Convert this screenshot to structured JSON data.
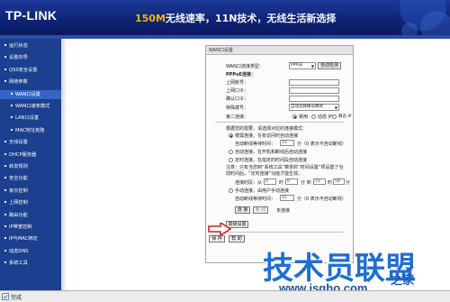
{
  "header": {
    "logo": "TP-LINK",
    "slogan_highlight": "150M",
    "slogan_rest": "无线速率，11N技术，无线生活新选择"
  },
  "menu": {
    "items": [
      {
        "label": "运行状态",
        "sub": false
      },
      {
        "label": "设置向导",
        "sub": false
      },
      {
        "label": "QSS安全设置",
        "sub": false
      },
      {
        "label": "网络参数",
        "sub": false
      },
      {
        "label": "WAN口设置",
        "sub": true,
        "active": true
      },
      {
        "label": "WAN口速率模式",
        "sub": true
      },
      {
        "label": "LAN口设置",
        "sub": true
      },
      {
        "label": "MAC地址克隆",
        "sub": true
      },
      {
        "label": "无线设置",
        "sub": false
      },
      {
        "label": "DHCP服务器",
        "sub": false
      },
      {
        "label": "转发规则",
        "sub": false
      },
      {
        "label": "安全功能",
        "sub": false
      },
      {
        "label": "家长控制",
        "sub": false
      },
      {
        "label": "上网控制",
        "sub": false
      },
      {
        "label": "路由功能",
        "sub": false
      },
      {
        "label": "IP带宽控制",
        "sub": false
      },
      {
        "label": "IP与MAC绑定",
        "sub": false
      },
      {
        "label": "动态DNS",
        "sub": false
      },
      {
        "label": "系统工具",
        "sub": false
      }
    ]
  },
  "panel": {
    "title": "WAN口设置",
    "wan_type_label": "WAN口连接类型：",
    "wan_type_value": "PPPoE",
    "auto_detect": "自动检测",
    "pppoe_conn": "PPPoE连接：",
    "account_label": "上网账号：",
    "password_label": "上网口令：",
    "confirm_label": "确认口令：",
    "special_dial_label": "特殊拨号：",
    "special_dial_value": "自动选择拨号模式",
    "second_conn_label": "第二连接：",
    "radio_disabled": "禁用",
    "radio_dynamic": "动态 IP",
    "radio_static": "静态 IP",
    "mode_hint": "根据您的需要，请选择对应的连接模式：",
    "opt_demand": "按需连接，在有访问时自动连接",
    "idle_label": "自动断线等待时间：",
    "idle_value": "15",
    "idle_unit": "分（0 表示不自动断线）",
    "opt_auto": "自动连接，在开机和断线后自动连接",
    "opt_timed": "定时连接，在指定的时间段自动连接",
    "note": "注意：只有当您到“系统工具”菜单的“时间设置”项设置了当前时间后，“定时连接”功能才能生效。",
    "period_label": "连接时段：从",
    "from_h": "0",
    "unit_h": "时",
    "from_m": "0",
    "unit_m_to": "分 到",
    "to_h": "23",
    "to_m": "59",
    "unit_m": "分",
    "opt_manual": "手动连接，由用户手动连接",
    "idle2_value": "15",
    "connect_btn": "连 接",
    "disconnect_btn": "断 线",
    "not_connected": "未连接",
    "advanced_btn": "高级设置",
    "save_btn": "保 存",
    "help_btn": "帮 助"
  },
  "status_bar": {
    "text": "完成"
  },
  "watermark": {
    "main": "技术员联盟",
    "url": "www.jsgho.com",
    "corner": "之家",
    "partial": "i."
  }
}
